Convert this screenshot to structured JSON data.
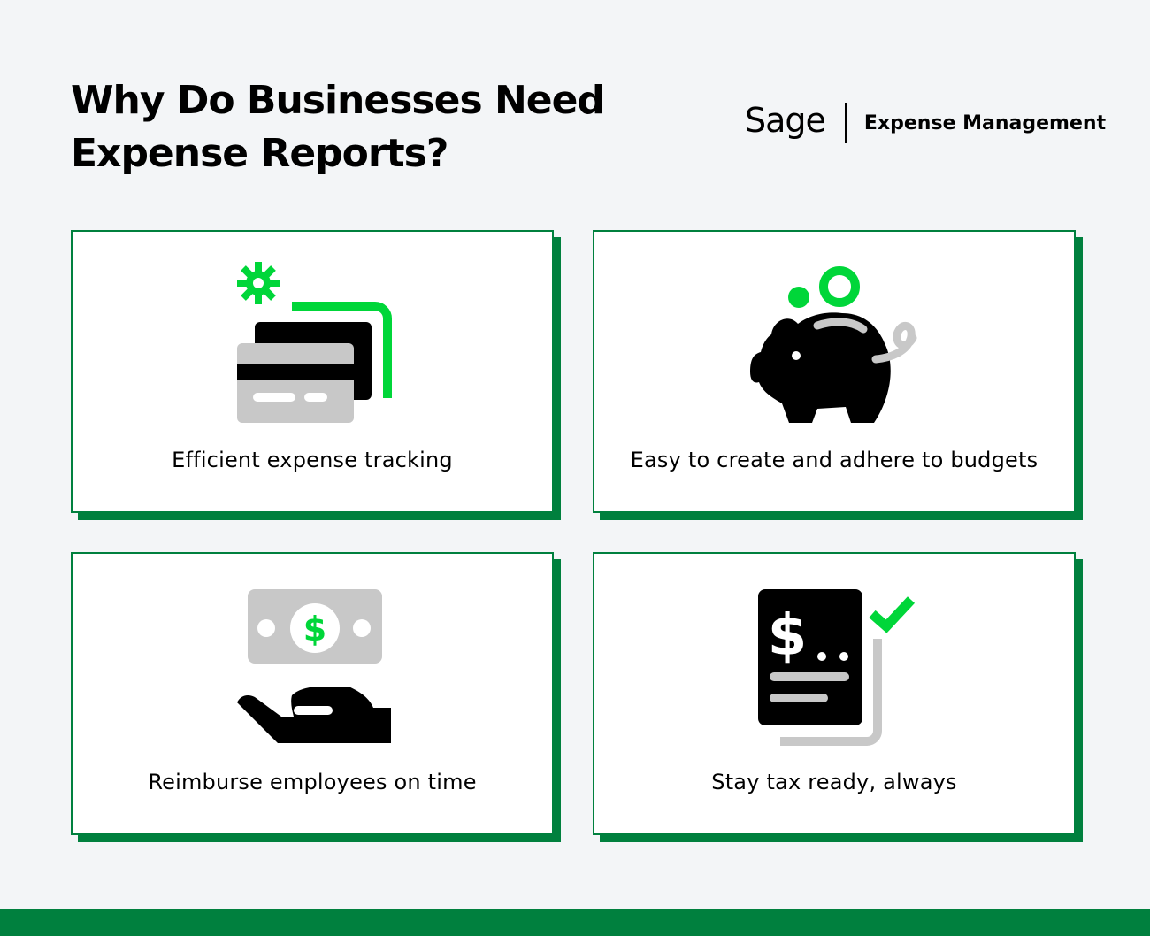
{
  "header": {
    "title_line1": "Why Do Businesses Need",
    "title_line2": "Expense Reports?",
    "brand_logo": "Sage",
    "brand_sub": "Expense Management"
  },
  "cards": [
    {
      "label": "Efficient expense tracking",
      "icon": "credit-cards-gear-icon"
    },
    {
      "label": "Easy to create and adhere to budgets",
      "icon": "piggy-bank-icon"
    },
    {
      "label": "Reimburse employees on time",
      "icon": "cash-hand-icon"
    },
    {
      "label": "Stay tax ready, always",
      "icon": "tax-receipt-check-icon"
    }
  ],
  "colors": {
    "accent_green": "#00803e",
    "bright_green": "#00d639",
    "icon_gray": "#c8c8c8",
    "background": "#f3f5f7"
  }
}
